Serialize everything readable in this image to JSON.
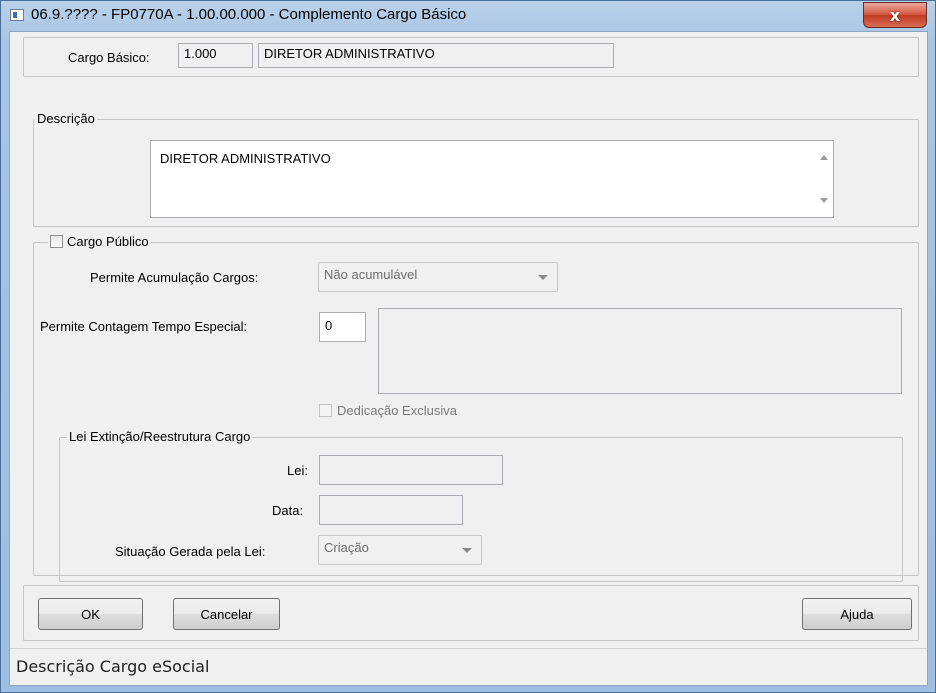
{
  "window": {
    "title": "06.9.???? - FP0770A - 1.00.00.000 - Complemento Cargo Básico",
    "close_label": "x"
  },
  "cargo_basico": {
    "label": "Cargo Básico:",
    "code": "1.000",
    "name": "DIRETOR ADMINISTRATIVO"
  },
  "descricao": {
    "group_label": "Descrição",
    "value": "DIRETOR ADMINISTRATIVO"
  },
  "cargo_publico": {
    "checkbox_label": "Cargo Público",
    "acumulacao_label": "Permite Acumulação Cargos:",
    "acumulacao_value": "Não acumulável",
    "contagem_label": "Permite Contagem Tempo Especial:",
    "contagem_value": "0",
    "contagem_desc": "",
    "dedicacao_label": "Dedicação Exclusiva"
  },
  "lei_group": {
    "group_label": "Lei Extinção/Reestrutura Cargo",
    "lei_label": "Lei:",
    "lei_value": "",
    "data_label": "Data:",
    "data_value": "",
    "situacao_label": "Situação Gerada pela Lei:",
    "situacao_value": "Criação"
  },
  "buttons": {
    "ok": "OK",
    "cancel": "Cancelar",
    "help": "Ajuda"
  },
  "status_bar": {
    "text": "Descrição Cargo eSocial"
  }
}
